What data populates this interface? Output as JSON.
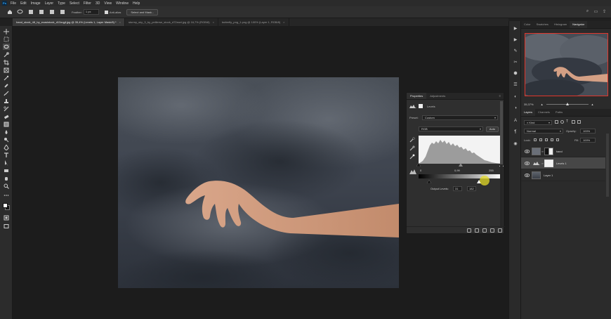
{
  "menubar": {
    "items": [
      "File",
      "Edit",
      "Image",
      "Layer",
      "Type",
      "Select",
      "Filter",
      "3D",
      "View",
      "Window",
      "Help"
    ]
  },
  "options": {
    "feather_label": "Feather:",
    "feather_value": "1 px",
    "antialias_label": "Anti-alias",
    "select_mask_label": "Select and Mask..."
  },
  "tabs": [
    {
      "label": "hand_stock_48_by_ecasistock_d13zqgf.jpg @ 35,4% (Levels 1, Layer Mask/8) *",
      "active": true
    },
    {
      "label": "stormy_sky_3_by_peilierse_stock_d72zwd.jpg @ 16,7% (RGB/8)",
      "active": false
    },
    {
      "label": "butterfly_png_1.png @ 100% (Layer 1, RGB/8)",
      "active": false
    }
  ],
  "properties": {
    "tab_properties": "Properties",
    "tab_adjustments": "Adjustments",
    "title": "Levels",
    "preset_label": "Preset:",
    "preset_value": "Custom",
    "channel_value": "RGB",
    "auto_label": "Auto",
    "input_black": "0",
    "input_gamma": "0,99",
    "input_white": "255",
    "output_label": "Output Levels:",
    "output_black": "31",
    "output_white": "182"
  },
  "right": {
    "tabs": [
      "Color",
      "Swatches",
      "Histogram",
      "Navigator"
    ],
    "active_tab": "Navigator",
    "zoom": "35,37%"
  },
  "layers": {
    "tabs": [
      "Layers",
      "Channels",
      "Paths"
    ],
    "filter_label": "Kind",
    "blend_mode": "Normal",
    "opacity_label": "Opacity:",
    "opacity_value": "100%",
    "lock_label": "Lock:",
    "fill_label": "Fill:",
    "fill_value": "100%",
    "items": [
      {
        "name": "hand",
        "selected": false
      },
      {
        "name": "Levels 1",
        "selected": true
      },
      {
        "name": "Layer 1",
        "selected": false
      }
    ]
  },
  "colors": {
    "accent_red": "#e0362c",
    "cursor_highlight": "#e6dc28"
  }
}
